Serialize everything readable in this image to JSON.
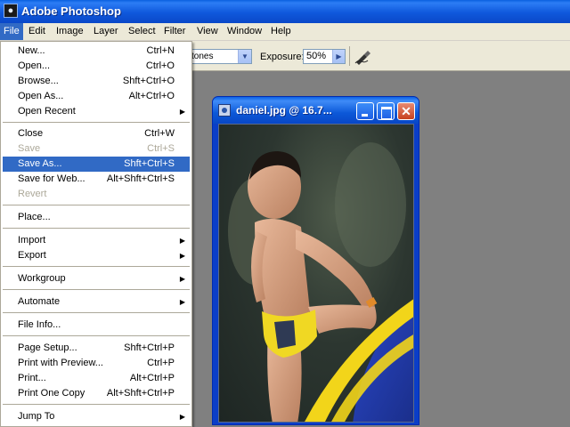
{
  "app": {
    "title": "Adobe Photoshop",
    "icon": "photoshop-app-icon"
  },
  "menubar": {
    "items": [
      {
        "label": "File",
        "active": true
      },
      {
        "label": "Edit"
      },
      {
        "label": "Image"
      },
      {
        "label": "Layer"
      },
      {
        "label": "Select"
      },
      {
        "label": "Filter"
      },
      {
        "label": "View"
      },
      {
        "label": "Window"
      },
      {
        "label": "Help"
      }
    ]
  },
  "options": {
    "range_value": "tones",
    "exposure_label": "Exposure:",
    "exposure_value": "50%",
    "airbrush_icon": "airbrush-icon"
  },
  "document": {
    "title": "daniel.jpg @ 16.7..."
  },
  "file_menu": {
    "items": [
      {
        "label": "New...",
        "shortcut": "Ctrl+N"
      },
      {
        "label": "Open...",
        "shortcut": "Ctrl+O"
      },
      {
        "label": "Browse...",
        "shortcut": "Shft+Ctrl+O"
      },
      {
        "label": "Open As...",
        "shortcut": "Alt+Ctrl+O"
      },
      {
        "label": "Open Recent",
        "submenu": true
      },
      {
        "label": "Close",
        "shortcut": "Ctrl+W"
      },
      {
        "label": "Save",
        "shortcut": "Ctrl+S",
        "disabled": true
      },
      {
        "label": "Save As...",
        "shortcut": "Shft+Ctrl+S",
        "highlighted": true
      },
      {
        "label": "Save for Web...",
        "shortcut": "Alt+Shft+Ctrl+S"
      },
      {
        "label": "Revert",
        "disabled": true
      },
      {
        "label": "Place..."
      },
      {
        "label": "Import",
        "submenu": true
      },
      {
        "label": "Export",
        "submenu": true
      },
      {
        "label": "Workgroup",
        "submenu": true
      },
      {
        "label": "Automate",
        "submenu": true
      },
      {
        "label": "File Info..."
      },
      {
        "label": "Page Setup...",
        "shortcut": "Shft+Ctrl+P"
      },
      {
        "label": "Print with Preview...",
        "shortcut": "Ctrl+P"
      },
      {
        "label": "Print...",
        "shortcut": "Alt+Ctrl+P"
      },
      {
        "label": "Print One Copy",
        "shortcut": "Alt+Shft+Ctrl+P"
      },
      {
        "label": "Jump To",
        "submenu": true
      }
    ]
  },
  "colors": {
    "highlight": "#316ac5",
    "titlebar": "#0a48c8",
    "workspace": "#808080"
  }
}
